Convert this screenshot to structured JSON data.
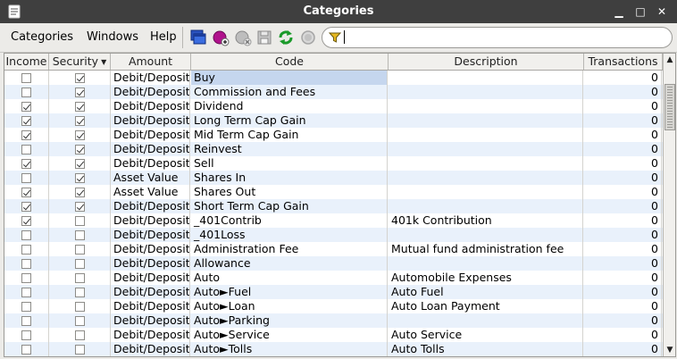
{
  "window": {
    "title": "Categories",
    "minimize": "▁",
    "maximize": "□",
    "close": "✕"
  },
  "menu": [
    {
      "label": "Categories",
      "mnemonic": "C"
    },
    {
      "label": "Windows",
      "mnemonic": "W"
    },
    {
      "label": "Help",
      "mnemonic": "H"
    }
  ],
  "toolbar": {
    "icons": [
      "new-window-icon",
      "add-category-icon",
      "delete-category-icon",
      "save-icon",
      "refresh-icon",
      "disabled-circle-icon"
    ]
  },
  "filter": {
    "value": "",
    "placeholder": ""
  },
  "colors": {
    "alt_row": "#e9f1fb",
    "selected_cell": "#c5d6ee",
    "titlebar": "#3f3f3f"
  },
  "table": {
    "columns": [
      "Income",
      "Security",
      "Amount",
      "Code",
      "Description",
      "Transactions"
    ],
    "sorted_column": "Security",
    "rows": [
      {
        "income": false,
        "security": true,
        "amount": "Debit/Deposit",
        "code": "Buy",
        "description": "",
        "transactions": "0"
      },
      {
        "income": false,
        "security": true,
        "amount": "Debit/Deposit",
        "code": "Commission and Fees",
        "description": "",
        "transactions": "0"
      },
      {
        "income": true,
        "security": true,
        "amount": "Debit/Deposit",
        "code": "Dividend",
        "description": "",
        "transactions": "0"
      },
      {
        "income": true,
        "security": true,
        "amount": "Debit/Deposit",
        "code": "Long Term Cap Gain",
        "description": "",
        "transactions": "0"
      },
      {
        "income": true,
        "security": true,
        "amount": "Debit/Deposit",
        "code": "Mid Term Cap Gain",
        "description": "",
        "transactions": "0"
      },
      {
        "income": false,
        "security": true,
        "amount": "Debit/Deposit",
        "code": "Reinvest",
        "description": "",
        "transactions": "0"
      },
      {
        "income": true,
        "security": true,
        "amount": "Debit/Deposit",
        "code": "Sell",
        "description": "",
        "transactions": "0"
      },
      {
        "income": false,
        "security": true,
        "amount": "Asset Value",
        "code": "Shares In",
        "description": "",
        "transactions": "0"
      },
      {
        "income": true,
        "security": true,
        "amount": "Asset Value",
        "code": "Shares Out",
        "description": "",
        "transactions": "0"
      },
      {
        "income": true,
        "security": true,
        "amount": "Debit/Deposit",
        "code": "Short Term Cap Gain",
        "description": "",
        "transactions": "0"
      },
      {
        "income": true,
        "security": false,
        "amount": "Debit/Deposit",
        "code": "_401Contrib",
        "description": "401k Contribution",
        "transactions": "0"
      },
      {
        "income": false,
        "security": false,
        "amount": "Debit/Deposit",
        "code": "_401Loss",
        "description": "",
        "transactions": "0"
      },
      {
        "income": false,
        "security": false,
        "amount": "Debit/Deposit",
        "code": "Administration Fee",
        "description": "Mutual fund administration fee",
        "transactions": "0"
      },
      {
        "income": false,
        "security": false,
        "amount": "Debit/Deposit",
        "code": "Allowance",
        "description": "",
        "transactions": "0"
      },
      {
        "income": false,
        "security": false,
        "amount": "Debit/Deposit",
        "code": "Auto",
        "description": "Automobile Expenses",
        "transactions": "0"
      },
      {
        "income": false,
        "security": false,
        "amount": "Debit/Deposit",
        "code": "Auto►Fuel",
        "description": "Auto Fuel",
        "transactions": "0"
      },
      {
        "income": false,
        "security": false,
        "amount": "Debit/Deposit",
        "code": "Auto►Loan",
        "description": "Auto Loan Payment",
        "transactions": "0"
      },
      {
        "income": false,
        "security": false,
        "amount": "Debit/Deposit",
        "code": "Auto►Parking",
        "description": "",
        "transactions": "0"
      },
      {
        "income": false,
        "security": false,
        "amount": "Debit/Deposit",
        "code": "Auto►Service",
        "description": "Auto Service",
        "transactions": "0"
      },
      {
        "income": false,
        "security": false,
        "amount": "Debit/Deposit",
        "code": "Auto►Tolls",
        "description": "Auto Tolls",
        "transactions": "0"
      }
    ]
  }
}
